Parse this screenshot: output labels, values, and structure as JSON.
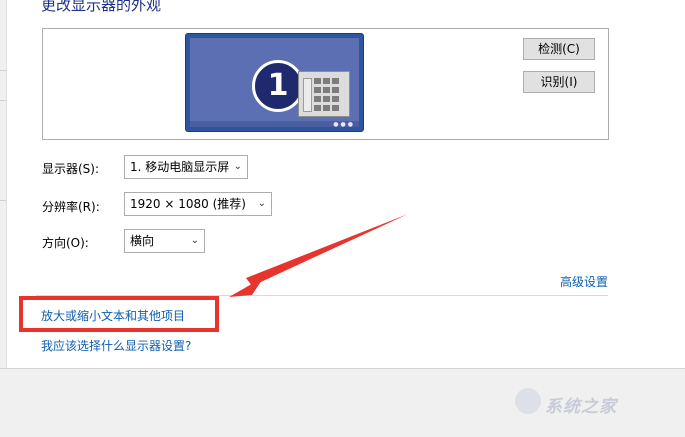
{
  "section": {
    "title": "更改显示器的外观"
  },
  "preview": {
    "monitor_number": "1"
  },
  "buttons": {
    "detect": "检测(C)",
    "identify": "识别(I)"
  },
  "settings": {
    "display": {
      "label": "显示器(S):",
      "value": "1. 移动电脑显示屏"
    },
    "resolution": {
      "label": "分辨率(R):",
      "value": "1920 × 1080 (推荐)"
    },
    "orientation": {
      "label": "方向(O):",
      "value": "横向"
    }
  },
  "links": {
    "advanced": "高级设置",
    "zoom_text": "放大或缩小文本和其他项目",
    "which_settings": "我应该选择什么显示器设置?"
  },
  "annotation": {
    "color": "#e8342d"
  },
  "watermark": {
    "text": "系统之家"
  },
  "colors": {
    "link": "#0f5fb0",
    "title": "#1e3287",
    "monitor": "#2e55a0"
  }
}
